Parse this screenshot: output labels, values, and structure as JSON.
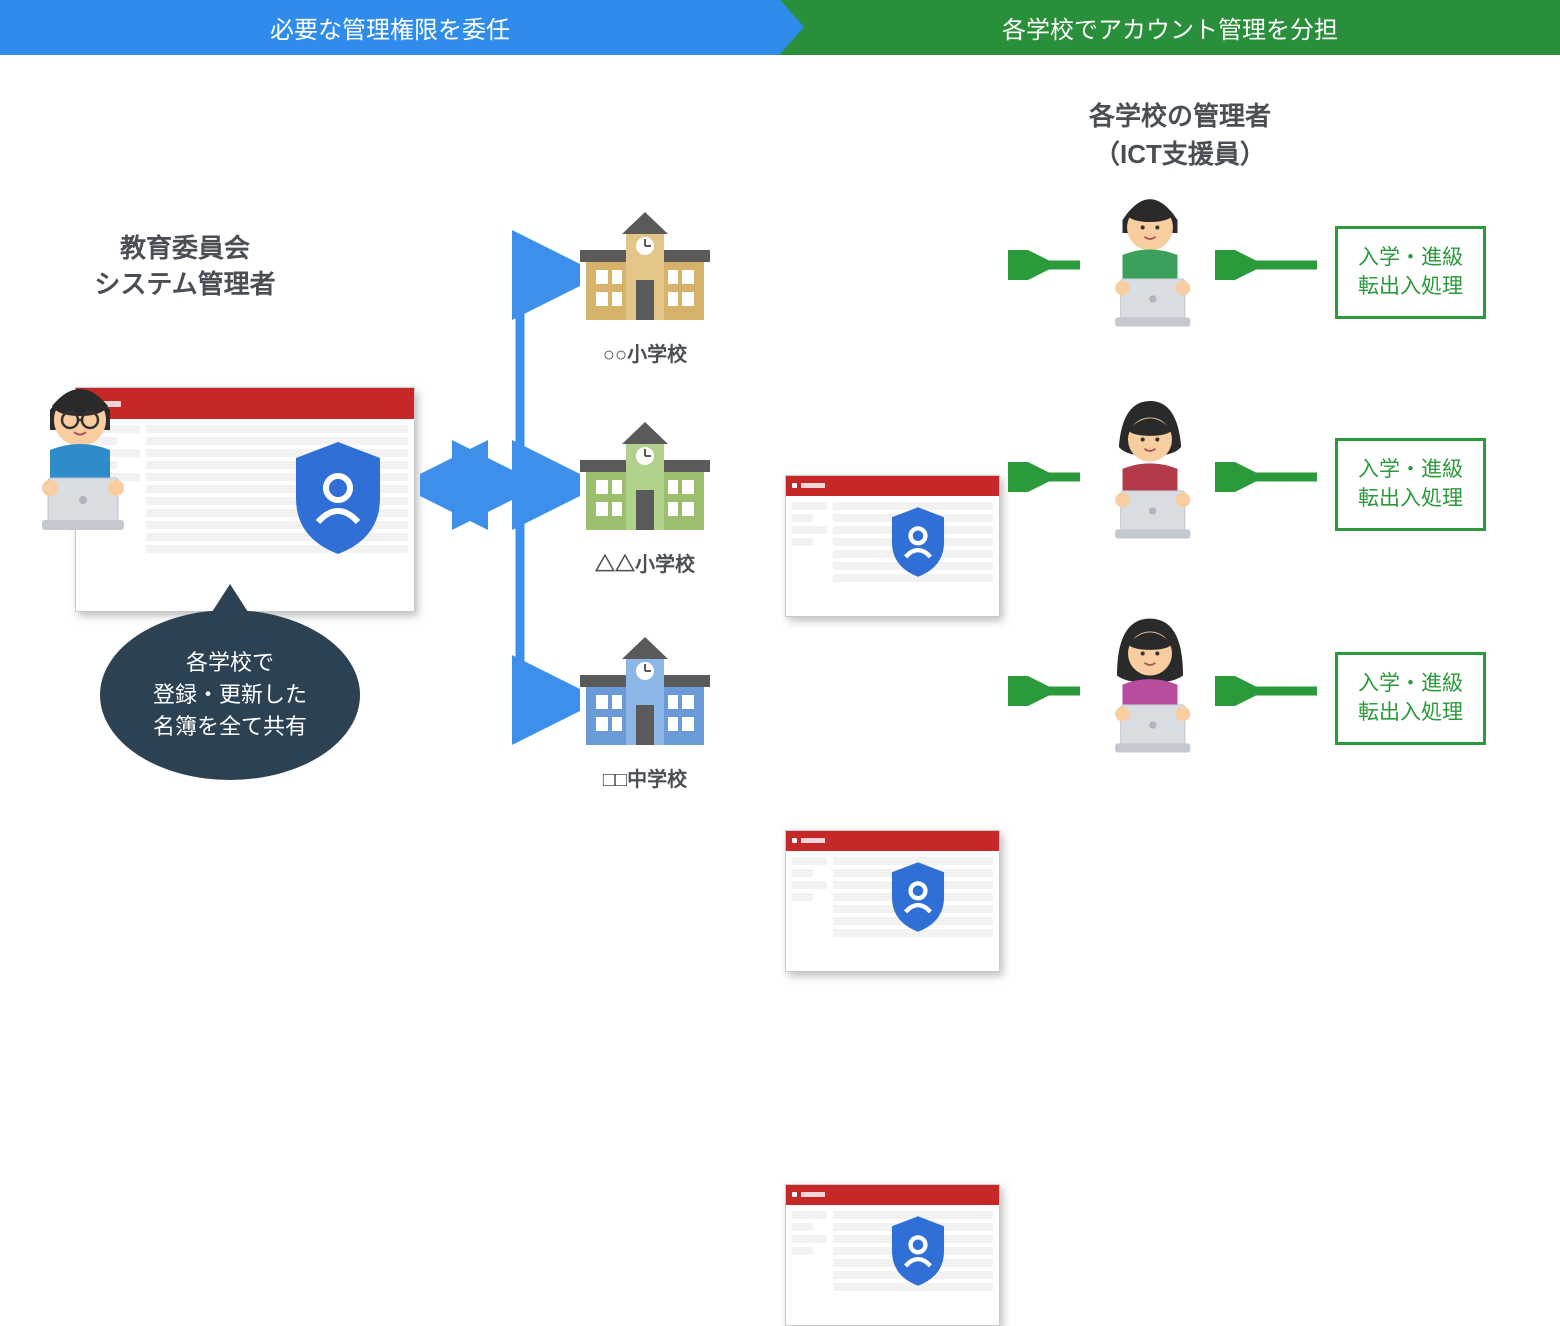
{
  "header": {
    "left": "必要な管理権限を委任",
    "right": "各学校でアカウント管理を分担"
  },
  "admin": {
    "title1": "教育委員会",
    "title2": "システム管理者",
    "bubble_l1": "各学校で",
    "bubble_l2": "登録・更新した",
    "bubble_l3": "名簿を全て共有"
  },
  "schools": [
    {
      "name": "○○小学校",
      "color": "#d7b26a",
      "roof": "#5a5a5a"
    },
    {
      "name": "△△小学校",
      "color": "#9cbf6f",
      "roof": "#5a5a5a"
    },
    {
      "name": "□□中学校",
      "color": "#6a9bd8",
      "roof": "#5a5a5a"
    }
  ],
  "school_admin": {
    "title1": "各学校の管理者",
    "title2": "（ICT支援員）"
  },
  "task": {
    "line1": "入学・進級",
    "line2": "転出入処理"
  },
  "colors": {
    "blue": "#2f8cea",
    "green": "#2a9a3a"
  }
}
